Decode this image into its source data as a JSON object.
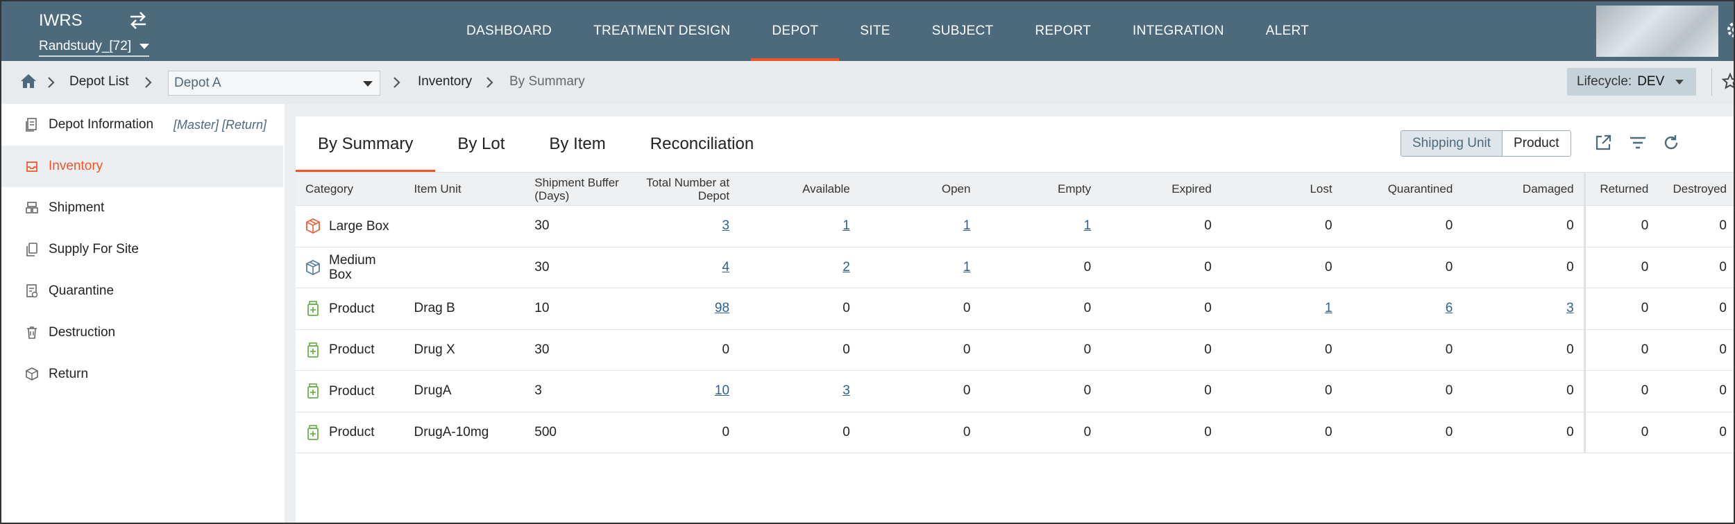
{
  "header": {
    "app_title": "IWRS",
    "study": "Randstudy_[72]",
    "nav": [
      "DASHBOARD",
      "TREATMENT DESIGN",
      "DEPOT",
      "SITE",
      "SUBJECT",
      "REPORT",
      "INTEGRATION",
      "ALERT"
    ],
    "active_nav": "DEPOT"
  },
  "breadcrumb": {
    "depot_list": "Depot List",
    "depot_selected": "Depot A",
    "inventory": "Inventory",
    "by_summary": "By Summary",
    "lifecycle_label": "Lifecycle:",
    "lifecycle_value": "DEV"
  },
  "sidebar": {
    "items": [
      {
        "label": "Depot Information",
        "icon": "file-icon",
        "tag": "[Master] [Return]"
      },
      {
        "label": "Inventory",
        "icon": "inbox-icon",
        "active": true
      },
      {
        "label": "Shipment",
        "icon": "shipment-icon"
      },
      {
        "label": "Supply For Site",
        "icon": "copy-icon"
      },
      {
        "label": "Quarantine",
        "icon": "quarantine-icon"
      },
      {
        "label": "Destruction",
        "icon": "trash-icon"
      },
      {
        "label": "Return",
        "icon": "package-icon"
      }
    ]
  },
  "tabs": [
    "By Summary",
    "By Lot",
    "By Item",
    "Reconciliation"
  ],
  "toggle": {
    "shipping_unit": "Shipping Unit",
    "product": "Product",
    "active": "Shipping Unit"
  },
  "table": {
    "columns": [
      "Category",
      "Item Unit",
      "Shipment Buffer (Days)",
      "Total Number at Depot",
      "Available",
      "Open",
      "Empty",
      "Expired",
      "Lost",
      "Quarantined",
      "Damaged",
      "Returned",
      "Destroyed"
    ],
    "rows": [
      {
        "category": "Large Box",
        "icon": "box-orange-icon",
        "item_unit": "",
        "buffer": "30",
        "total": "3",
        "available": "1",
        "open": "1",
        "empty": "1",
        "expired": "0",
        "lost": "0",
        "quarantined": "0",
        "damaged": "0",
        "returned": "0",
        "destroyed": "0"
      },
      {
        "category": "Medium Box",
        "icon": "box-blue-icon",
        "item_unit": "",
        "buffer": "30",
        "total": "4",
        "available": "2",
        "open": "1",
        "empty": "0",
        "expired": "0",
        "lost": "0",
        "quarantined": "0",
        "damaged": "0",
        "returned": "0",
        "destroyed": "0"
      },
      {
        "category": "Product",
        "icon": "product-icon",
        "item_unit": "Drag B",
        "buffer": "10",
        "total": "98",
        "available": "0",
        "open": "0",
        "empty": "0",
        "expired": "0",
        "lost": "1",
        "quarantined": "6",
        "damaged": "3",
        "returned": "0",
        "destroyed": "0"
      },
      {
        "category": "Product",
        "icon": "product-icon",
        "item_unit": "Drug X",
        "buffer": "30",
        "total": "0",
        "available": "0",
        "open": "0",
        "empty": "0",
        "expired": "0",
        "lost": "0",
        "quarantined": "0",
        "damaged": "0",
        "returned": "0",
        "destroyed": "0"
      },
      {
        "category": "Product",
        "icon": "product-icon",
        "item_unit": "DrugA",
        "buffer": "3",
        "total": "10",
        "available": "3",
        "open": "0",
        "empty": "0",
        "expired": "0",
        "lost": "0",
        "quarantined": "0",
        "damaged": "0",
        "returned": "0",
        "destroyed": "0"
      },
      {
        "category": "Product",
        "icon": "product-icon",
        "item_unit": "DrugA-10mg",
        "buffer": "500",
        "total": "0",
        "available": "0",
        "open": "0",
        "empty": "0",
        "expired": "0",
        "lost": "0",
        "quarantined": "0",
        "damaged": "0",
        "returned": "0",
        "destroyed": "0"
      }
    ]
  },
  "colors": {
    "header": "#4c6a7c",
    "accent": "#f0552a",
    "link": "#2f5f8f",
    "product_green": "#6ab04c",
    "box_orange": "#e8613a",
    "box_blue": "#5b7f9a"
  }
}
